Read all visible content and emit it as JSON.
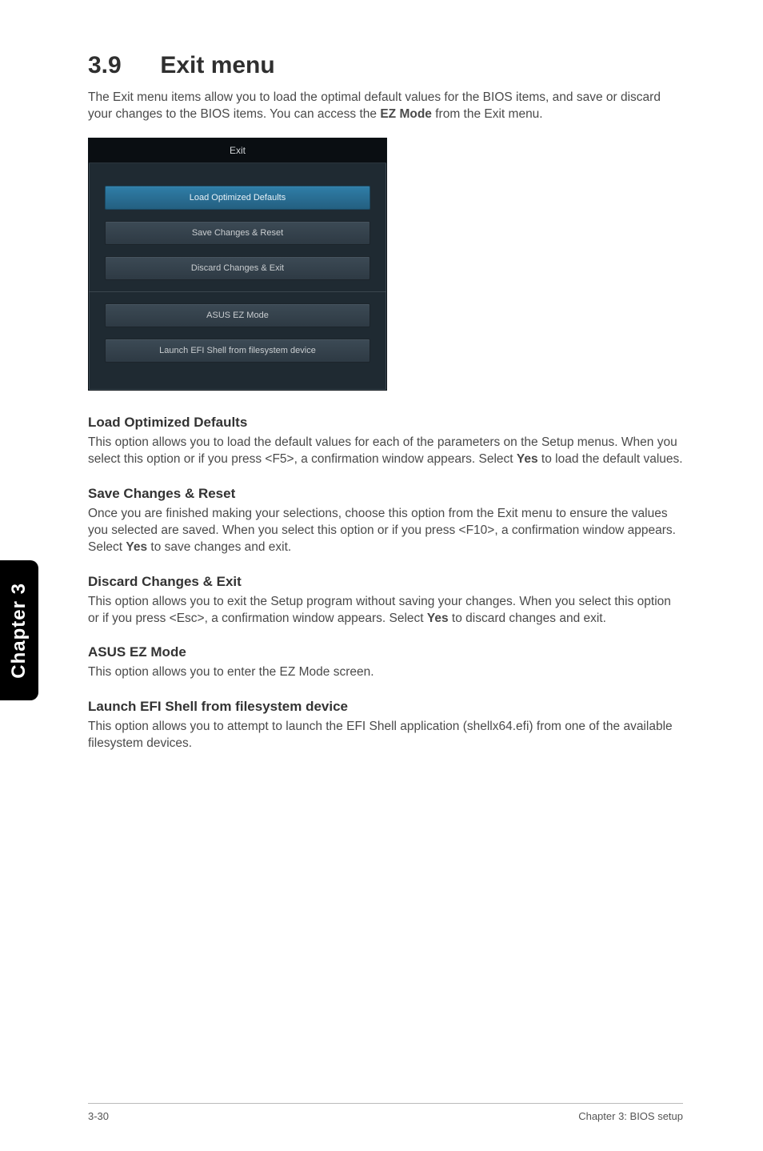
{
  "side_tab": "Chapter 3",
  "section": {
    "number": "3.9",
    "title": "Exit menu"
  },
  "intro_a": "The Exit menu items allow you to load the optimal default values for the BIOS items, and save or discard your changes to the BIOS items. You can access the ",
  "intro_ezmode": "EZ Mode",
  "intro_b": " from the Exit menu.",
  "bios": {
    "title": "Exit",
    "buttons": {
      "load_defaults": "Load Optimized Defaults",
      "save_reset": "Save Changes & Reset",
      "discard_exit": "Discard Changes & Exit",
      "ez_mode": "ASUS EZ Mode",
      "launch_efi": "Launch EFI Shell from filesystem device"
    }
  },
  "sections": {
    "load_defaults": {
      "heading": "Load Optimized Defaults",
      "body_a": "This option allows you to load the default values for each of the parameters on the Setup menus. When you select this option or if you press <F5>, a confirmation window appears. Select ",
      "yes": "Yes",
      "body_b": " to load the default values."
    },
    "save_reset": {
      "heading": "Save Changes & Reset",
      "body_a": "Once you are finished making your selections, choose this option from the Exit menu to ensure the values you selected are saved. When you select this option or if you press <F10>, a confirmation window appears. Select ",
      "yes": "Yes",
      "body_b": " to save changes and exit."
    },
    "discard_exit": {
      "heading": "Discard Changes & Exit",
      "body_a": "This option allows you to exit the Setup program without saving your changes. When you select this option or if you press <Esc>, a confirmation window appears. Select ",
      "yes": "Yes",
      "body_b": " to discard changes and exit."
    },
    "ez_mode": {
      "heading": "ASUS EZ Mode",
      "body": "This option allows you to enter the EZ Mode screen."
    },
    "launch_efi": {
      "heading": "Launch EFI Shell from filesystem device",
      "body": "This option allows you to attempt to launch the EFI Shell application (shellx64.efi) from one of the available filesystem devices."
    }
  },
  "footer": {
    "left": "3-30",
    "right": "Chapter 3: BIOS setup"
  }
}
